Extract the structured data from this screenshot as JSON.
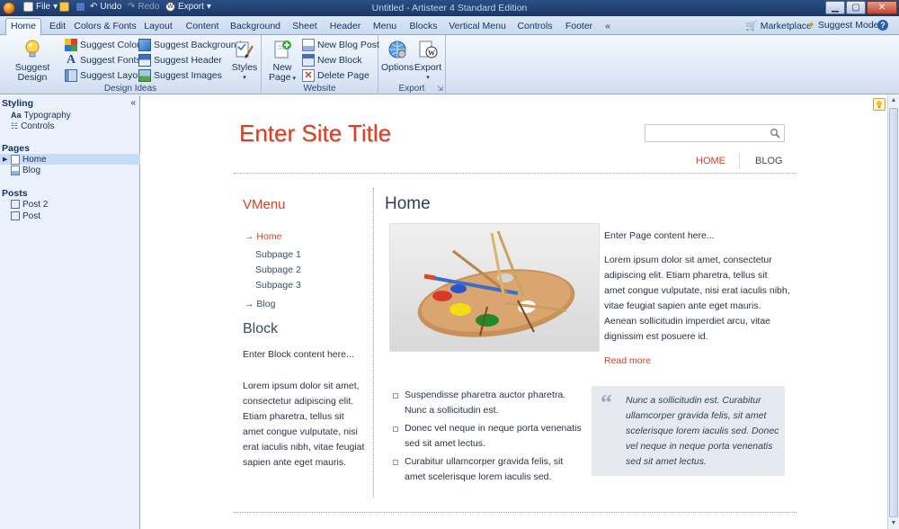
{
  "window": {
    "title": "Untitled - Artisteer 4 Standard Edition",
    "file_label": "File",
    "undo_label": "Undo",
    "redo_label": "Redo",
    "export_label": "Export"
  },
  "tabs": [
    {
      "label": "Home"
    },
    {
      "label": "Edit"
    },
    {
      "label": "Colors & Fonts"
    },
    {
      "label": "Layout"
    },
    {
      "label": "Content"
    },
    {
      "label": "Background"
    },
    {
      "label": "Sheet"
    },
    {
      "label": "Header"
    },
    {
      "label": "Menu"
    },
    {
      "label": "Blocks"
    },
    {
      "label": "Vertical Menu"
    },
    {
      "label": "Controls"
    },
    {
      "label": "Footer"
    },
    {
      "label": "«"
    }
  ],
  "right_tools": {
    "marketplace": "Marketplace",
    "suggest_mode": "Suggest Mode",
    "help": "?"
  },
  "ribbon": {
    "suggest_design": "Suggest Design",
    "suggest_colors": "Suggest Colors",
    "suggest_fonts": "Suggest Fonts",
    "suggest_layout": "Suggest Layout",
    "suggest_background": "Suggest Background",
    "suggest_header": "Suggest Header",
    "suggest_images": "Suggest Images",
    "styles": "Styles",
    "group_design_ideas": "Design Ideas",
    "new_page_l1": "New",
    "new_page_l2": "Page",
    "new_blog_post": "New Blog Post",
    "new_block": "New Block",
    "delete_page": "Delete Page",
    "group_website": "Website",
    "options": "Options",
    "export": "Export",
    "group_export": "Export"
  },
  "left_panel": {
    "styling_header": "Styling",
    "typography": "Typography",
    "controls": "Controls",
    "pages_header": "Pages",
    "pages": [
      "Home",
      "Blog"
    ],
    "posts_header": "Posts",
    "posts": [
      "Post 2",
      "Post"
    ],
    "collapse": "«"
  },
  "site": {
    "title": "Enter Site Title",
    "nav": [
      "HOME",
      "BLOG"
    ],
    "vmenu_title": "VMenu",
    "vmenu": {
      "home": "Home",
      "sub1": "Subpage 1",
      "sub2": "Subpage 2",
      "sub3": "Subpage 3",
      "blog": "Blog"
    },
    "block_title": "Block",
    "block_intro": "Enter Block content here...",
    "block_lorem": [
      "Lorem ipsum dolor sit amet,",
      "consectetur adipiscing elit.",
      "Etiam pharetra, tellus sit",
      "amet congue vulputate, nisi",
      "erat iaculis nibh, vitae feugiat",
      "sapien ante eget mauris."
    ],
    "post_title": "Home",
    "post_intro": "Enter Page content here...",
    "post_lorem": [
      "Lorem ipsum dolor sit amet, consectetur",
      "adipiscing elit. Etiam pharetra, tellus sit",
      "amet congue vulputate, nisi erat iaculis nibh,",
      "vitae feugiat sapien ante eget mauris.",
      "Aenean sollicitudin imperdiet arcu, vitae",
      "dignissim est posuere id."
    ],
    "read_more": "Read more",
    "bullets": [
      [
        "Suspendisse pharetra auctor pharetra.",
        "Nunc a sollicitudin est."
      ],
      [
        "Donec vel neque in neque porta venenatis",
        "sed sit amet lectus."
      ],
      [
        "Curabitur ullamcorper gravida felis, sit",
        "amet scelerisque lorem iaculis sed."
      ]
    ],
    "quote": [
      "Nunc a sollicitudin est. Curabitur",
      "ullamcorper gravida felis, sit amet",
      "scelerisque lorem iaculis sed. Donec",
      "vel neque in neque porta venenatis",
      "sed sit amet lectus."
    ],
    "colors": {
      "accent": "#d8401f",
      "heading": "#2f3f58",
      "quote_bg": "#e6e9ef"
    }
  }
}
